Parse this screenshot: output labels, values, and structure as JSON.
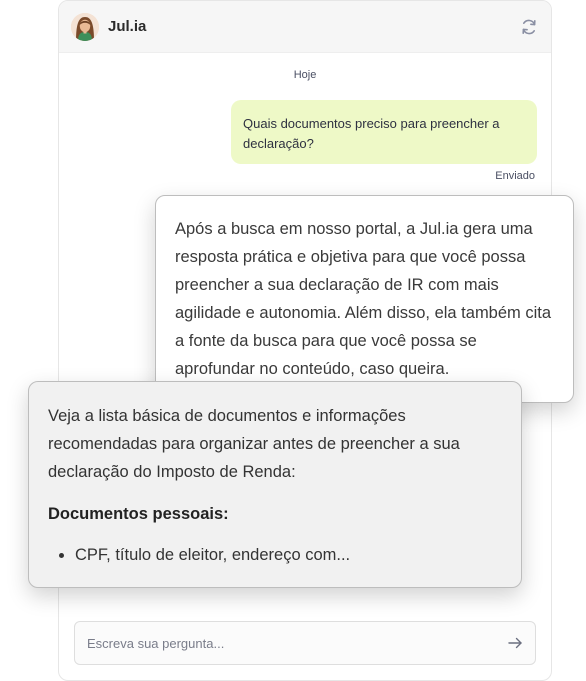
{
  "header": {
    "assistant_name": "Jul.ia",
    "avatar_icon": "assistant-avatar",
    "refresh_icon": "refresh-icon"
  },
  "conversation": {
    "day_label": "Hoje",
    "user_message": "Quais documentos preciso para preencher a declaração?",
    "sent_status": "Enviado"
  },
  "callouts": {
    "explanation": "Após a busca em nosso portal, a Jul.ia gera uma resposta prática e objetiva para que você possa preencher a sua declaração de IR com mais agilidade e autonomia. Além disso, ela também cita a fonte da busca para que você possa se aprofundar no conteúdo, caso queira.",
    "answer_intro": "Veja a lista básica de documentos e informações recomendadas para organizar antes de preencher a sua declaração do Imposto de Renda:",
    "answer_section_title": "Documentos pessoais:",
    "answer_items": [
      "CPF, título de eleitor, endereço com..."
    ]
  },
  "composer": {
    "placeholder": "Escreva sua pergunta...",
    "send_icon": "arrow-right-icon"
  },
  "colors": {
    "user_bubble": "#eef9c7",
    "header_bg": "#f6f6f6",
    "accent_text": "#4a4f63"
  }
}
